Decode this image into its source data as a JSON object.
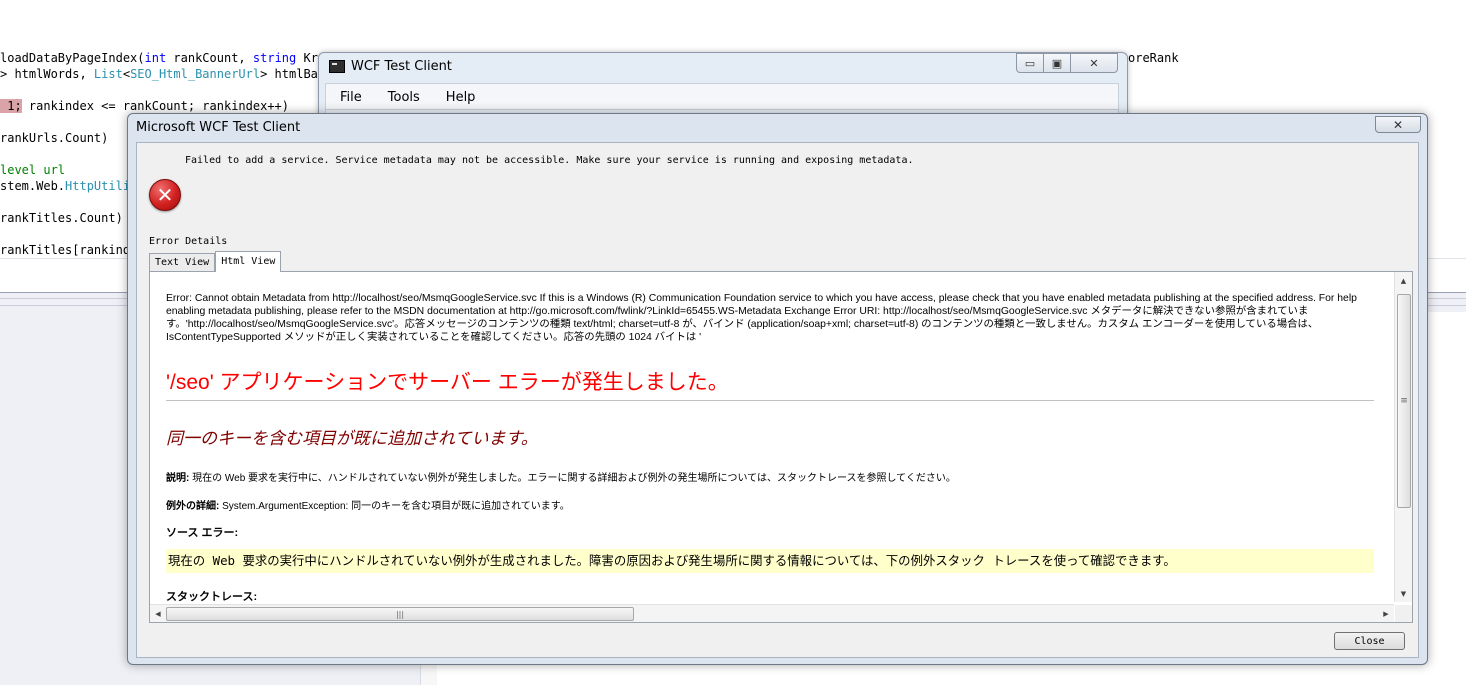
{
  "editor": {
    "lines": [
      {
        "segments": [
          {
            "t": "loadDataByPageIndex(",
            "c": ""
          },
          {
            "t": "int",
            "c": "kw"
          },
          {
            "t": " rankCount, ",
            "c": ""
          },
          {
            "t": "string",
            "c": "kw"
          },
          {
            "t": " Krn",
            "c": ""
          }
        ]
      },
      {
        "segments": [
          {
            "t": "> htmlWords, ",
            "c": ""
          },
          {
            "t": "List",
            "c": "ty"
          },
          {
            "t": "<",
            "c": ""
          },
          {
            "t": "SEO_Html_BannerUrl",
            "c": "ty"
          },
          {
            "t": "> htmlBan",
            "c": ""
          }
        ]
      },
      {
        "segments": [
          {
            "t": " 1;",
            "c": "hl"
          },
          {
            "t": " rankindex <= rankCount; rankindex++)",
            "c": ""
          }
        ]
      },
      {
        "segments": [
          {
            "t": "rankUrls.Count)",
            "c": ""
          }
        ]
      },
      {
        "segments": [
          {
            "t": "level url",
            "c": "cm"
          }
        ]
      },
      {
        "segments": [
          {
            "t": "stem.Web.",
            "c": ""
          },
          {
            "t": "HttpUtili",
            "c": "ty"
          }
        ]
      },
      {
        "segments": [
          {
            "t": "rankTitles.Count)",
            "c": ""
          }
        ]
      },
      {
        "segments": [
          {
            "t": "rankTitles[rankind",
            "c": ""
          }
        ]
      }
    ],
    "right_text": "oreRank"
  },
  "back_window": {
    "title": "WCF Test Client",
    "menu": [
      "File",
      "Tools",
      "Help"
    ]
  },
  "dialog": {
    "title": "Microsoft WCF Test Client",
    "message": "Failed to add a service. Service metadata may not be accessible. Make sure your service is running and exposing metadata.",
    "error_details_label": "Error Details",
    "tabs": [
      "Text View",
      "Html View"
    ],
    "active_tab": "Html View",
    "close_label": "Close",
    "html_view": {
      "error_paragraph": "Error: Cannot obtain Metadata from http://localhost/seo/MsmqGoogleService.svc If this is a Windows (R) Communication Foundation service to which you have access, please check that you have enabled metadata publishing at the specified address. For help enabling metadata publishing, please refer to the MSDN documentation at http://go.microsoft.com/fwlink/?LinkId=65455.WS-Metadata Exchange Error URI: http://localhost/seo/MsmqGoogleService.svc メタデータに解決できない参照が含まれています。'http://localhost/seo/MsmqGoogleService.svc'。応答メッセージのコンテンツの種類 text/html; charset=utf-8 が、バインド (application/soap+xml; charset=utf-8) のコンテンツの種類と一致しません。カスタム エンコーダーを使用している場合は、IsContentTypeSupported メソッドが正しく実装されていることを確認してください。応答の先頭の 1024 バイトは '",
      "server_error_heading": "'/seo' アプリケーションでサーバー エラーが発生しました。",
      "exception_heading": "同一のキーを含む項目が既に追加されています。",
      "description_label": "説明:",
      "description_text": "現在の Web 要求を実行中に、ハンドルされていない例外が発生しました。エラーに関する詳細および例外の発生場所については、スタックトレースを参照してください。",
      "exception_label": "例外の詳細:",
      "exception_text": "System.ArgumentException: 同一のキーを含む項目が既に追加されています。",
      "source_error_label": "ソース エラー:",
      "source_error_text": "現在の Web 要求の実行中にハンドルされていない例外が生成されました。障害の原因および発生場所に関する情報については、下の例外スタック トレースを使って確認できます。",
      "stack_trace_label": "スタックトレース:"
    }
  }
}
